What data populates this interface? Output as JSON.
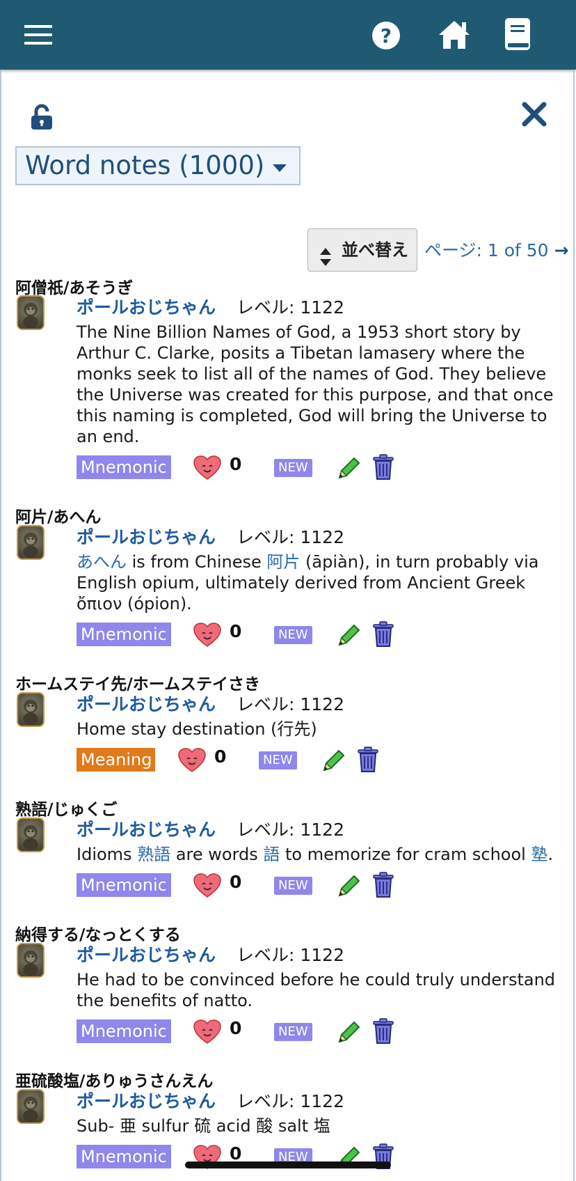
{
  "header": {
    "menu_icon": "hamburger-menu-icon",
    "help_icon": "question-circle-icon",
    "home_icon": "home-icon",
    "book_icon": "book-icon",
    "background": "#1f5a72"
  },
  "toolbar": {
    "lock_icon": "lock-open-icon",
    "close_icon": "close-x-icon"
  },
  "filter": {
    "selected": "Word notes (1000)"
  },
  "sort": {
    "label": "並べ替え"
  },
  "pagination": {
    "label": "ページ: ",
    "value": "1 of 50",
    "next": "→"
  },
  "notes": [
    {
      "title": "阿僧祇/あそうぎ",
      "author": "ポールおじちゃん",
      "level": "レベル: 1122",
      "body": "The Nine Billion Names of God, a 1953 short story by Arthur C. Clarke, posits a Tibetan lamasery where the monks seek to list all of the names of God. They believe the Universe was created for this purpose, and that once this naming is completed, God will bring the Universe to an end.",
      "tag": "Mnemonic",
      "likes": "0",
      "badge": "NEW"
    },
    {
      "title": "阿片/あへん",
      "author": "ポールおじちゃん",
      "level": "レベル: 1122",
      "body_parts": [
        {
          "text": "あへん",
          "link": true
        },
        {
          "text": " is from Chinese ",
          "link": false
        },
        {
          "text": "阿片",
          "link": true
        },
        {
          "text": " (āpiàn), in turn probably via English opium, ultimately derived from Ancient Greek ὄπιον (ópion).",
          "link": false
        }
      ],
      "tag": "Mnemonic",
      "likes": "0",
      "badge": "NEW"
    },
    {
      "title": "ホームステイ先/ホームステイさき",
      "author": "ポールおじちゃん",
      "level": "レベル: 1122",
      "body": "Home stay destination (行先)",
      "tag": "Meaning",
      "likes": "0",
      "badge": "NEW"
    },
    {
      "title": "熟語/じゅくご",
      "author": "ポールおじちゃん",
      "level": "レベル: 1122",
      "body_parts": [
        {
          "text": "Idioms ",
          "link": false
        },
        {
          "text": "熟語",
          "link": true
        },
        {
          "text": " are words ",
          "link": false
        },
        {
          "text": "語",
          "link": true
        },
        {
          "text": " to memorize for cram school ",
          "link": false
        },
        {
          "text": "塾",
          "link": true
        },
        {
          "text": ".",
          "link": false
        }
      ],
      "tag": "Mnemonic",
      "likes": "0",
      "badge": "NEW"
    },
    {
      "title": "納得する/なっとくする",
      "author": "ポールおじちゃん",
      "level": "レベル: 1122",
      "body": "He had to be convinced before he could truly understand the benefits of natto.",
      "tag": "Mnemonic",
      "likes": "0",
      "badge": "NEW"
    },
    {
      "title": "亜硫酸塩/ありゅうさんえん",
      "author": "ポールおじちゃん",
      "level": "レベル: 1122",
      "body": "Sub- 亜 sulfur 硫 acid 酸 salt 塩",
      "tag": "Mnemonic",
      "likes": "0",
      "badge": "NEW"
    }
  ],
  "colors": {
    "accent": "#1f5aa0",
    "mnemonic_tag": "#8f87ec",
    "meaning_tag": "#e07a1a",
    "heart": "#f06a7a",
    "pencil": "#4cc24c",
    "trash": "#7b78e6"
  }
}
